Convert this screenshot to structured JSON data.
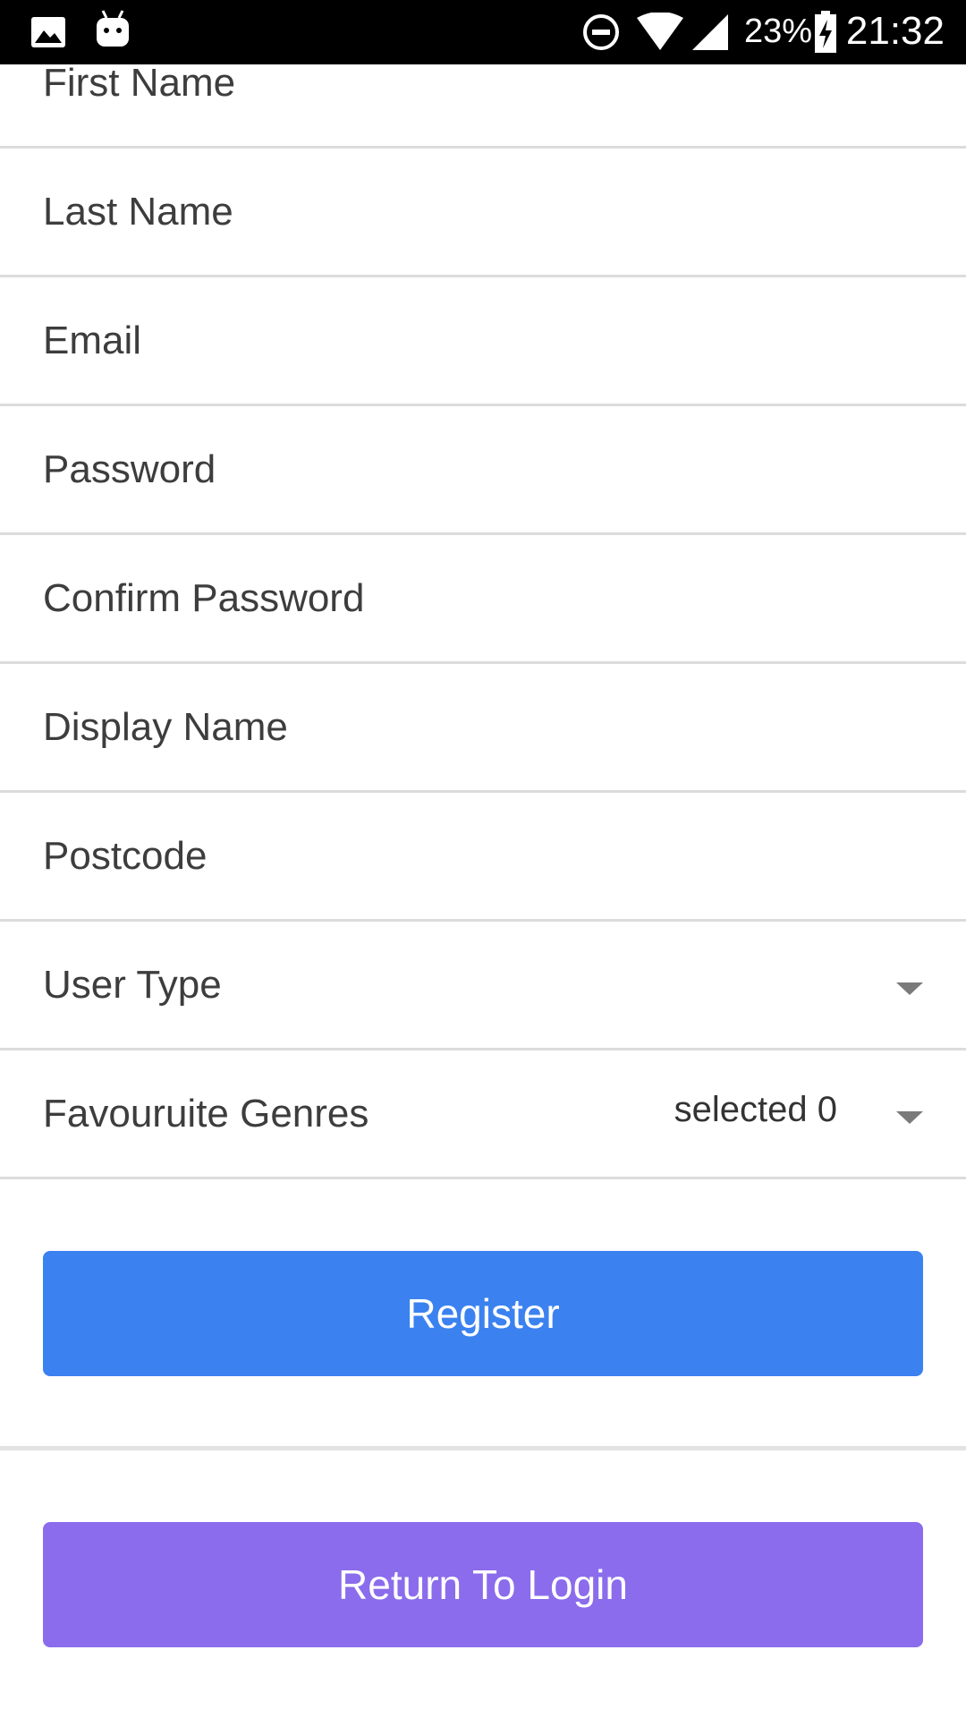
{
  "status_bar": {
    "battery": "23%",
    "time": "21:32",
    "icons": [
      "image-icon",
      "android-icon",
      "do-not-disturb-icon",
      "wifi-icon",
      "signal-icon",
      "battery-charging-icon"
    ]
  },
  "form": {
    "fields": [
      {
        "label": "First Name"
      },
      {
        "label": "Last Name"
      },
      {
        "label": "Email"
      },
      {
        "label": "Password"
      },
      {
        "label": "Confirm Password"
      },
      {
        "label": "Display Name"
      },
      {
        "label": "Postcode"
      },
      {
        "label": "User Type"
      },
      {
        "label": "Favouruite Genres",
        "value": "selected 0"
      }
    ]
  },
  "buttons": {
    "register": "Register",
    "return_login": "Return To Login"
  },
  "colors": {
    "register_bg": "#3b82f0",
    "return_bg": "#8b6cec"
  }
}
